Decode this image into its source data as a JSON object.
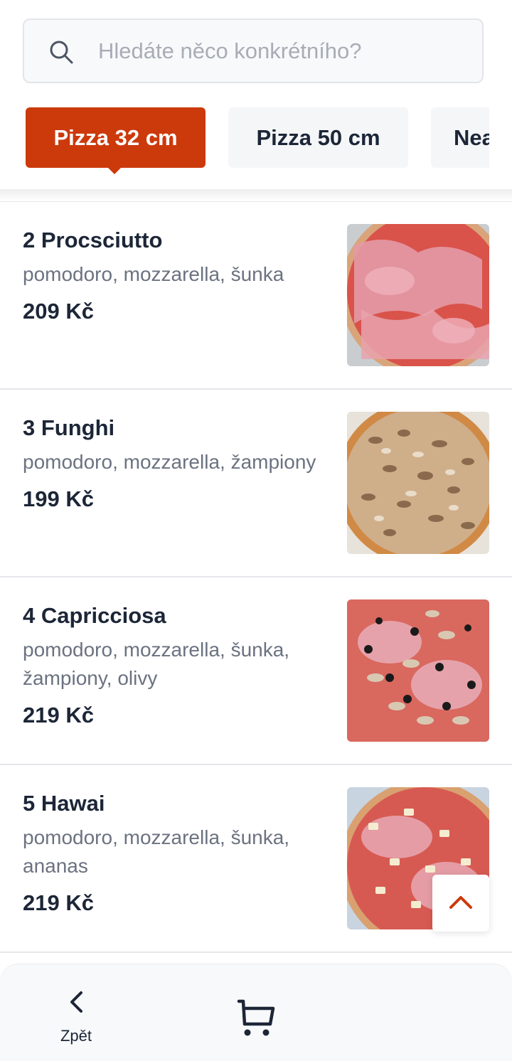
{
  "search": {
    "placeholder": "Hledáte něco konkrétního?",
    "icon": "search-icon"
  },
  "tabs": [
    {
      "label": "Pizza 32 cm",
      "active": true
    },
    {
      "label": "Pizza 50 cm",
      "active": false
    },
    {
      "label": "Nealko",
      "active": false
    }
  ],
  "items": [
    {
      "name": "2 Procsciutto",
      "desc": "pomodoro, mozzarella, šunka",
      "price": "209 Kč",
      "image": "prosciutto-pizza-photo"
    },
    {
      "name": "3 Funghi",
      "desc": "pomodoro, mozzarella, žampiony",
      "price": "199 Kč",
      "image": "funghi-pizza-photo"
    },
    {
      "name": "4 Capricciosa",
      "desc": "pomodoro, mozzarella, šunka, žampiony, olivy",
      "price": "219 Kč",
      "image": "capricciosa-pizza-photo"
    },
    {
      "name": "5 Hawai",
      "desc": "pomodoro, mozzarella, šunka, ananas",
      "price": "219 Kč",
      "image": "hawai-pizza-photo"
    }
  ],
  "bottom_nav": {
    "back_label": "Zpět",
    "back_icon": "chevron-left-icon",
    "cart_icon": "cart-icon"
  },
  "scroll_top_icon": "chevron-up-icon",
  "colors": {
    "accent": "#cc3a0c",
    "text": "#1c2637",
    "muted": "#6b7280"
  }
}
